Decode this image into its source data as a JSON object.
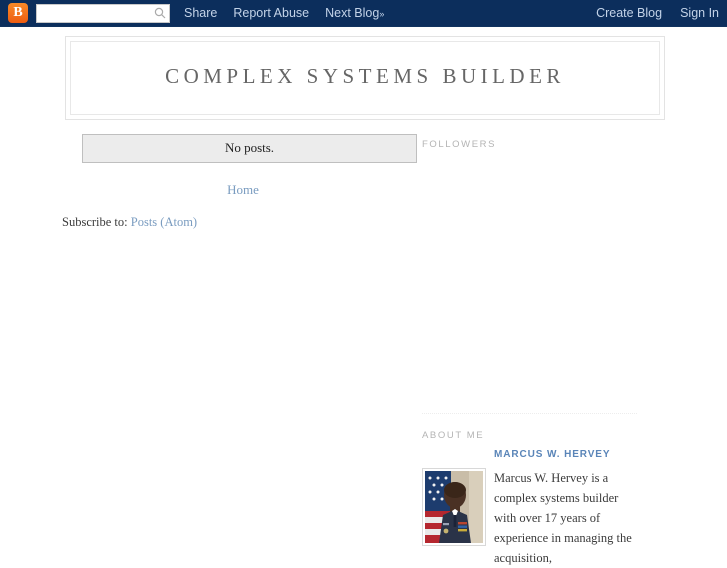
{
  "navbar": {
    "logo_letter": "B",
    "logo_icon": "blogger-logo-icon",
    "search_placeholder": "",
    "search_value": "",
    "search_icon": "search-icon",
    "links": [
      {
        "label": "Share"
      },
      {
        "label": "Report Abuse"
      },
      {
        "label": "Next Blog"
      }
    ],
    "next_blog_chevron": "»",
    "right_links": [
      {
        "label": "Create Blog"
      },
      {
        "label": "Sign In"
      }
    ],
    "background_color": "#0c2e5c",
    "link_color": "#c3d3e8"
  },
  "header": {
    "blog_title": "COMPLEX SYSTEMS BUILDER"
  },
  "main": {
    "status_message": "No posts.",
    "pager_home_label": "Home",
    "feed_prefix": "Subscribe to:",
    "feed_link_label": "Posts (Atom)"
  },
  "sidebar": {
    "followers": {
      "title": "FOLLOWERS"
    },
    "about_me": {
      "title": "ABOUT ME",
      "profile_name": "MARCUS W. HERVEY",
      "avatar_icon": "profile-photo",
      "bio": "Marcus W. Hervey is a complex systems builder with over 17 years of experience in managing the acquisition,"
    }
  },
  "colors": {
    "nav_bg": "#0c2e5c",
    "link_blue": "#7a9cc0",
    "profile_blue": "#5a85b8",
    "title_gray": "#666666",
    "widget_gray": "#b4b4b4",
    "status_bg": "#ececec"
  }
}
